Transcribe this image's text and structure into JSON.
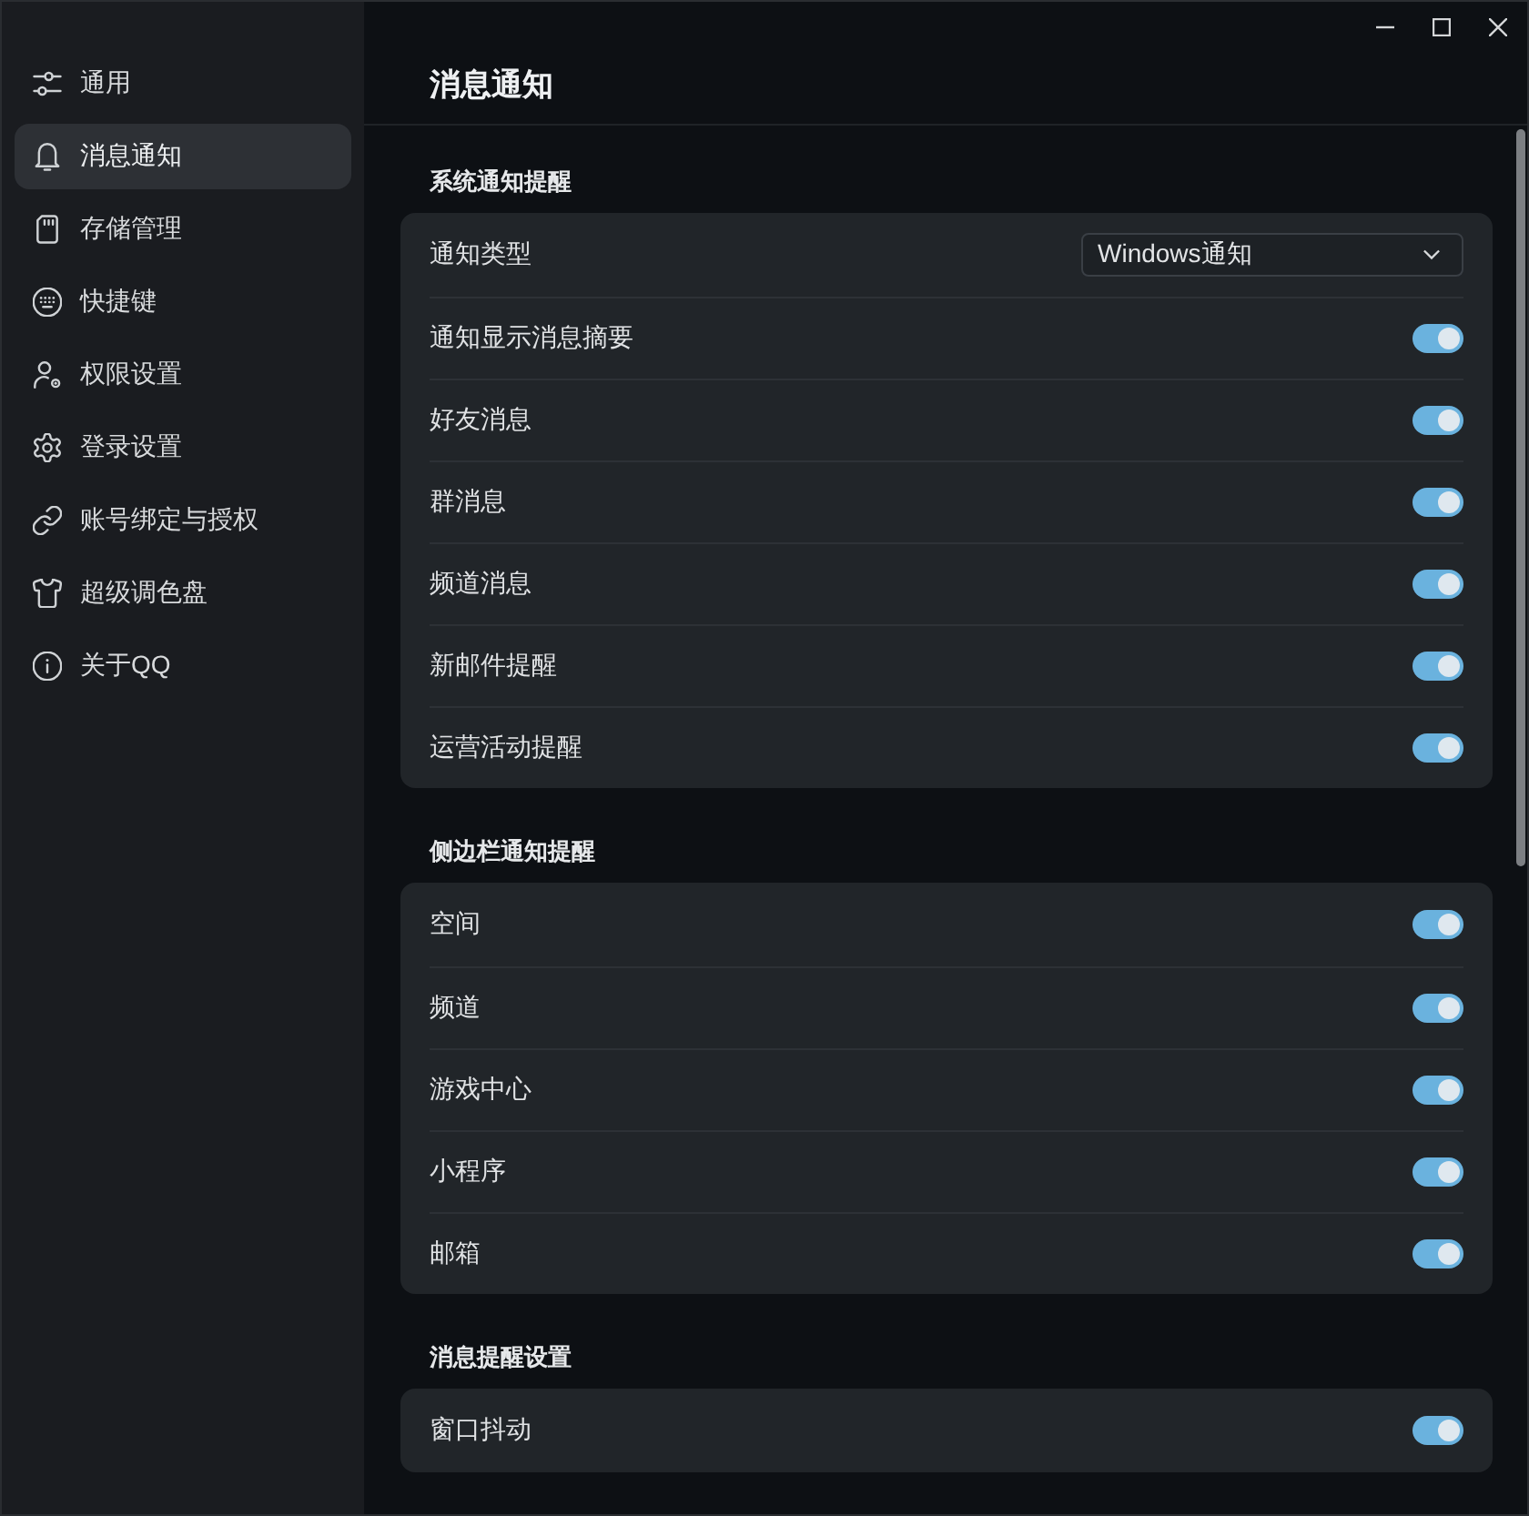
{
  "sidebar": {
    "items": [
      {
        "label": "通用",
        "selected": false
      },
      {
        "label": "消息通知",
        "selected": true
      },
      {
        "label": "存储管理",
        "selected": false
      },
      {
        "label": "快捷键",
        "selected": false
      },
      {
        "label": "权限设置",
        "selected": false
      },
      {
        "label": "登录设置",
        "selected": false
      },
      {
        "label": "账号绑定与授权",
        "selected": false
      },
      {
        "label": "超级调色盘",
        "selected": false
      },
      {
        "label": "关于QQ",
        "selected": false
      }
    ]
  },
  "page": {
    "title": "消息通知"
  },
  "sections": [
    {
      "heading": "系统通知提醒",
      "rows": [
        {
          "kind": "dropdown",
          "label": "通知类型",
          "value": "Windows通知"
        },
        {
          "kind": "toggle",
          "label": "通知显示消息摘要",
          "on": true
        },
        {
          "kind": "toggle",
          "label": "好友消息",
          "on": true
        },
        {
          "kind": "toggle",
          "label": "群消息",
          "on": true
        },
        {
          "kind": "toggle",
          "label": "频道消息",
          "on": true
        },
        {
          "kind": "toggle",
          "label": "新邮件提醒",
          "on": true
        },
        {
          "kind": "toggle",
          "label": "运营活动提醒",
          "on": true
        }
      ]
    },
    {
      "heading": "侧边栏通知提醒",
      "rows": [
        {
          "kind": "toggle",
          "label": "空间",
          "on": true
        },
        {
          "kind": "toggle",
          "label": "频道",
          "on": true
        },
        {
          "kind": "toggle",
          "label": "游戏中心",
          "on": true
        },
        {
          "kind": "toggle",
          "label": "小程序",
          "on": true
        },
        {
          "kind": "toggle",
          "label": "邮箱",
          "on": true
        }
      ]
    },
    {
      "heading": "消息提醒设置",
      "rows": [
        {
          "kind": "toggle",
          "label": "窗口抖动",
          "on": true
        }
      ]
    }
  ]
}
